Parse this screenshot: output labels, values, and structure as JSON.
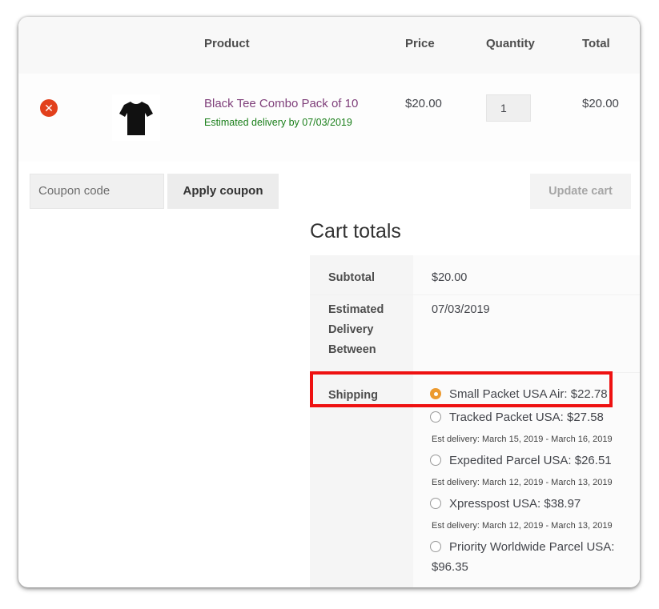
{
  "cart_table": {
    "headers": {
      "product": "Product",
      "price": "Price",
      "quantity": "Quantity",
      "total": "Total"
    },
    "items": [
      {
        "remove_icon": "remove-circle-x-icon",
        "thumbnail": "black-tshirt-image",
        "name": "Black Tee Combo Pack of 10",
        "delivery_note": "Estimated delivery by 07/03/2019",
        "price": "$20.00",
        "quantity": "1",
        "total": "$20.00"
      }
    ]
  },
  "actions": {
    "coupon_placeholder": "Coupon code",
    "apply_coupon_label": "Apply coupon",
    "update_cart_label": "Update cart"
  },
  "cart_totals": {
    "title": "Cart totals",
    "subtotal_label": "Subtotal",
    "subtotal_value": "$20.00",
    "delivery_label_line1": "Estimated",
    "delivery_label_line2": "Delivery",
    "delivery_label_line3": "Between",
    "delivery_value": "07/03/2019",
    "shipping_label": "Shipping",
    "shipping_options": [
      {
        "label": "Small Packet USA Air: $22.78",
        "selected": true,
        "est": ""
      },
      {
        "label": "Tracked Packet USA: $27.58",
        "selected": false,
        "est": "Est delivery: March 15, 2019 - March 16, 2019"
      },
      {
        "label": "Expedited Parcel USA: $26.51",
        "selected": false,
        "est": "Est delivery: March 12, 2019 - March 13, 2019"
      },
      {
        "label": "Xpresspost USA: $38.97",
        "selected": false,
        "est": "Est delivery: March 12, 2019 - March 13, 2019"
      },
      {
        "label": "Priority Worldwide Parcel USA:",
        "label_cont": "$96.35",
        "selected": false,
        "est": ""
      }
    ]
  },
  "colors": {
    "product_link": "#7f3f7a",
    "delivery_green": "#1a7f1a",
    "remove_red": "#e2401c",
    "radio_selected": "#ec9a2f",
    "highlight_box": "#ee1111"
  }
}
